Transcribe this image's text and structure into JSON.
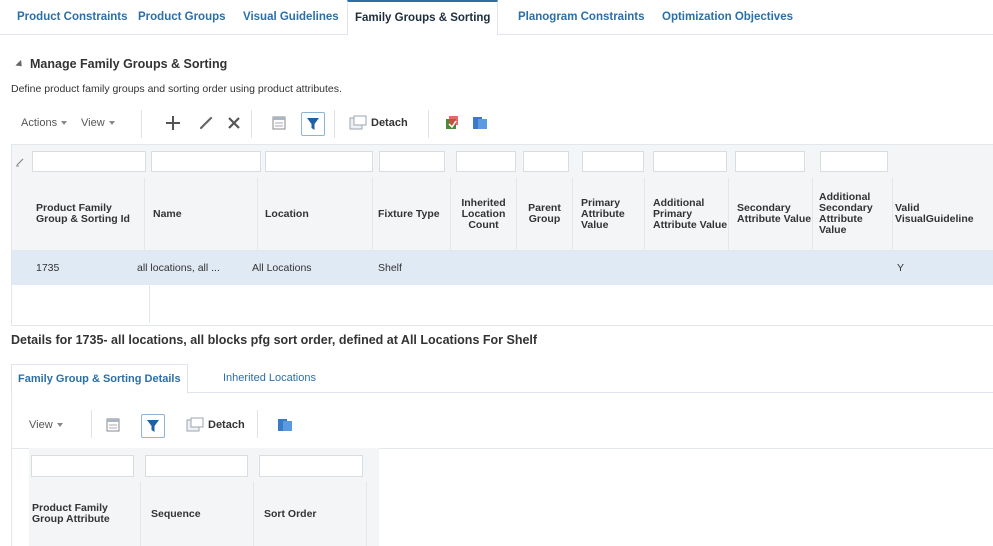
{
  "top_tabs": [
    "Product Constraints",
    "Product Groups",
    "Visual Guidelines",
    "Family Groups & Sorting",
    "Planogram Constraints",
    "Optimization Objectives"
  ],
  "section": {
    "title": "Manage Family Groups & Sorting",
    "subtitle": "Define product family groups and sorting order using product attributes."
  },
  "toolbar": {
    "actions_label": "Actions",
    "view_label": "View",
    "detach_label": "Detach"
  },
  "grid": {
    "columns": [
      "Product Family Group & Sorting Id",
      "Name",
      "Location",
      "Fixture Type",
      "Inherited Location Count",
      "Parent Group",
      "Primary Attribute Value",
      "Additional Primary Attribute Value",
      "Secondary Attribute Value",
      "Additional Secondary Attribute Value",
      "Valid VisualGuideline"
    ],
    "rows": [
      {
        "id": "1735",
        "name": "all locations, all ...",
        "location": "All Locations",
        "fixture_type": "Shelf",
        "inherited_count": "",
        "parent_group": "",
        "primary": "",
        "additional_primary": "",
        "secondary": "",
        "additional_secondary": "",
        "valid": "Y"
      }
    ]
  },
  "details": {
    "title": "Details for 1735- all locations, all blocks pfg sort order, defined at All Locations For Shelf",
    "tabs": [
      "Family Group & Sorting Details",
      "Inherited Locations"
    ],
    "toolbar": {
      "view_label": "View",
      "detach_label": "Detach"
    },
    "columns": [
      "Product Family Group Attribute",
      "Sequence",
      "Sort Order"
    ]
  },
  "colors": {
    "link": "#2b6fa8",
    "selected_row": "#dfeaf4",
    "header_bg": "#f3f5f7",
    "filter_active": "#1f5fa3"
  }
}
